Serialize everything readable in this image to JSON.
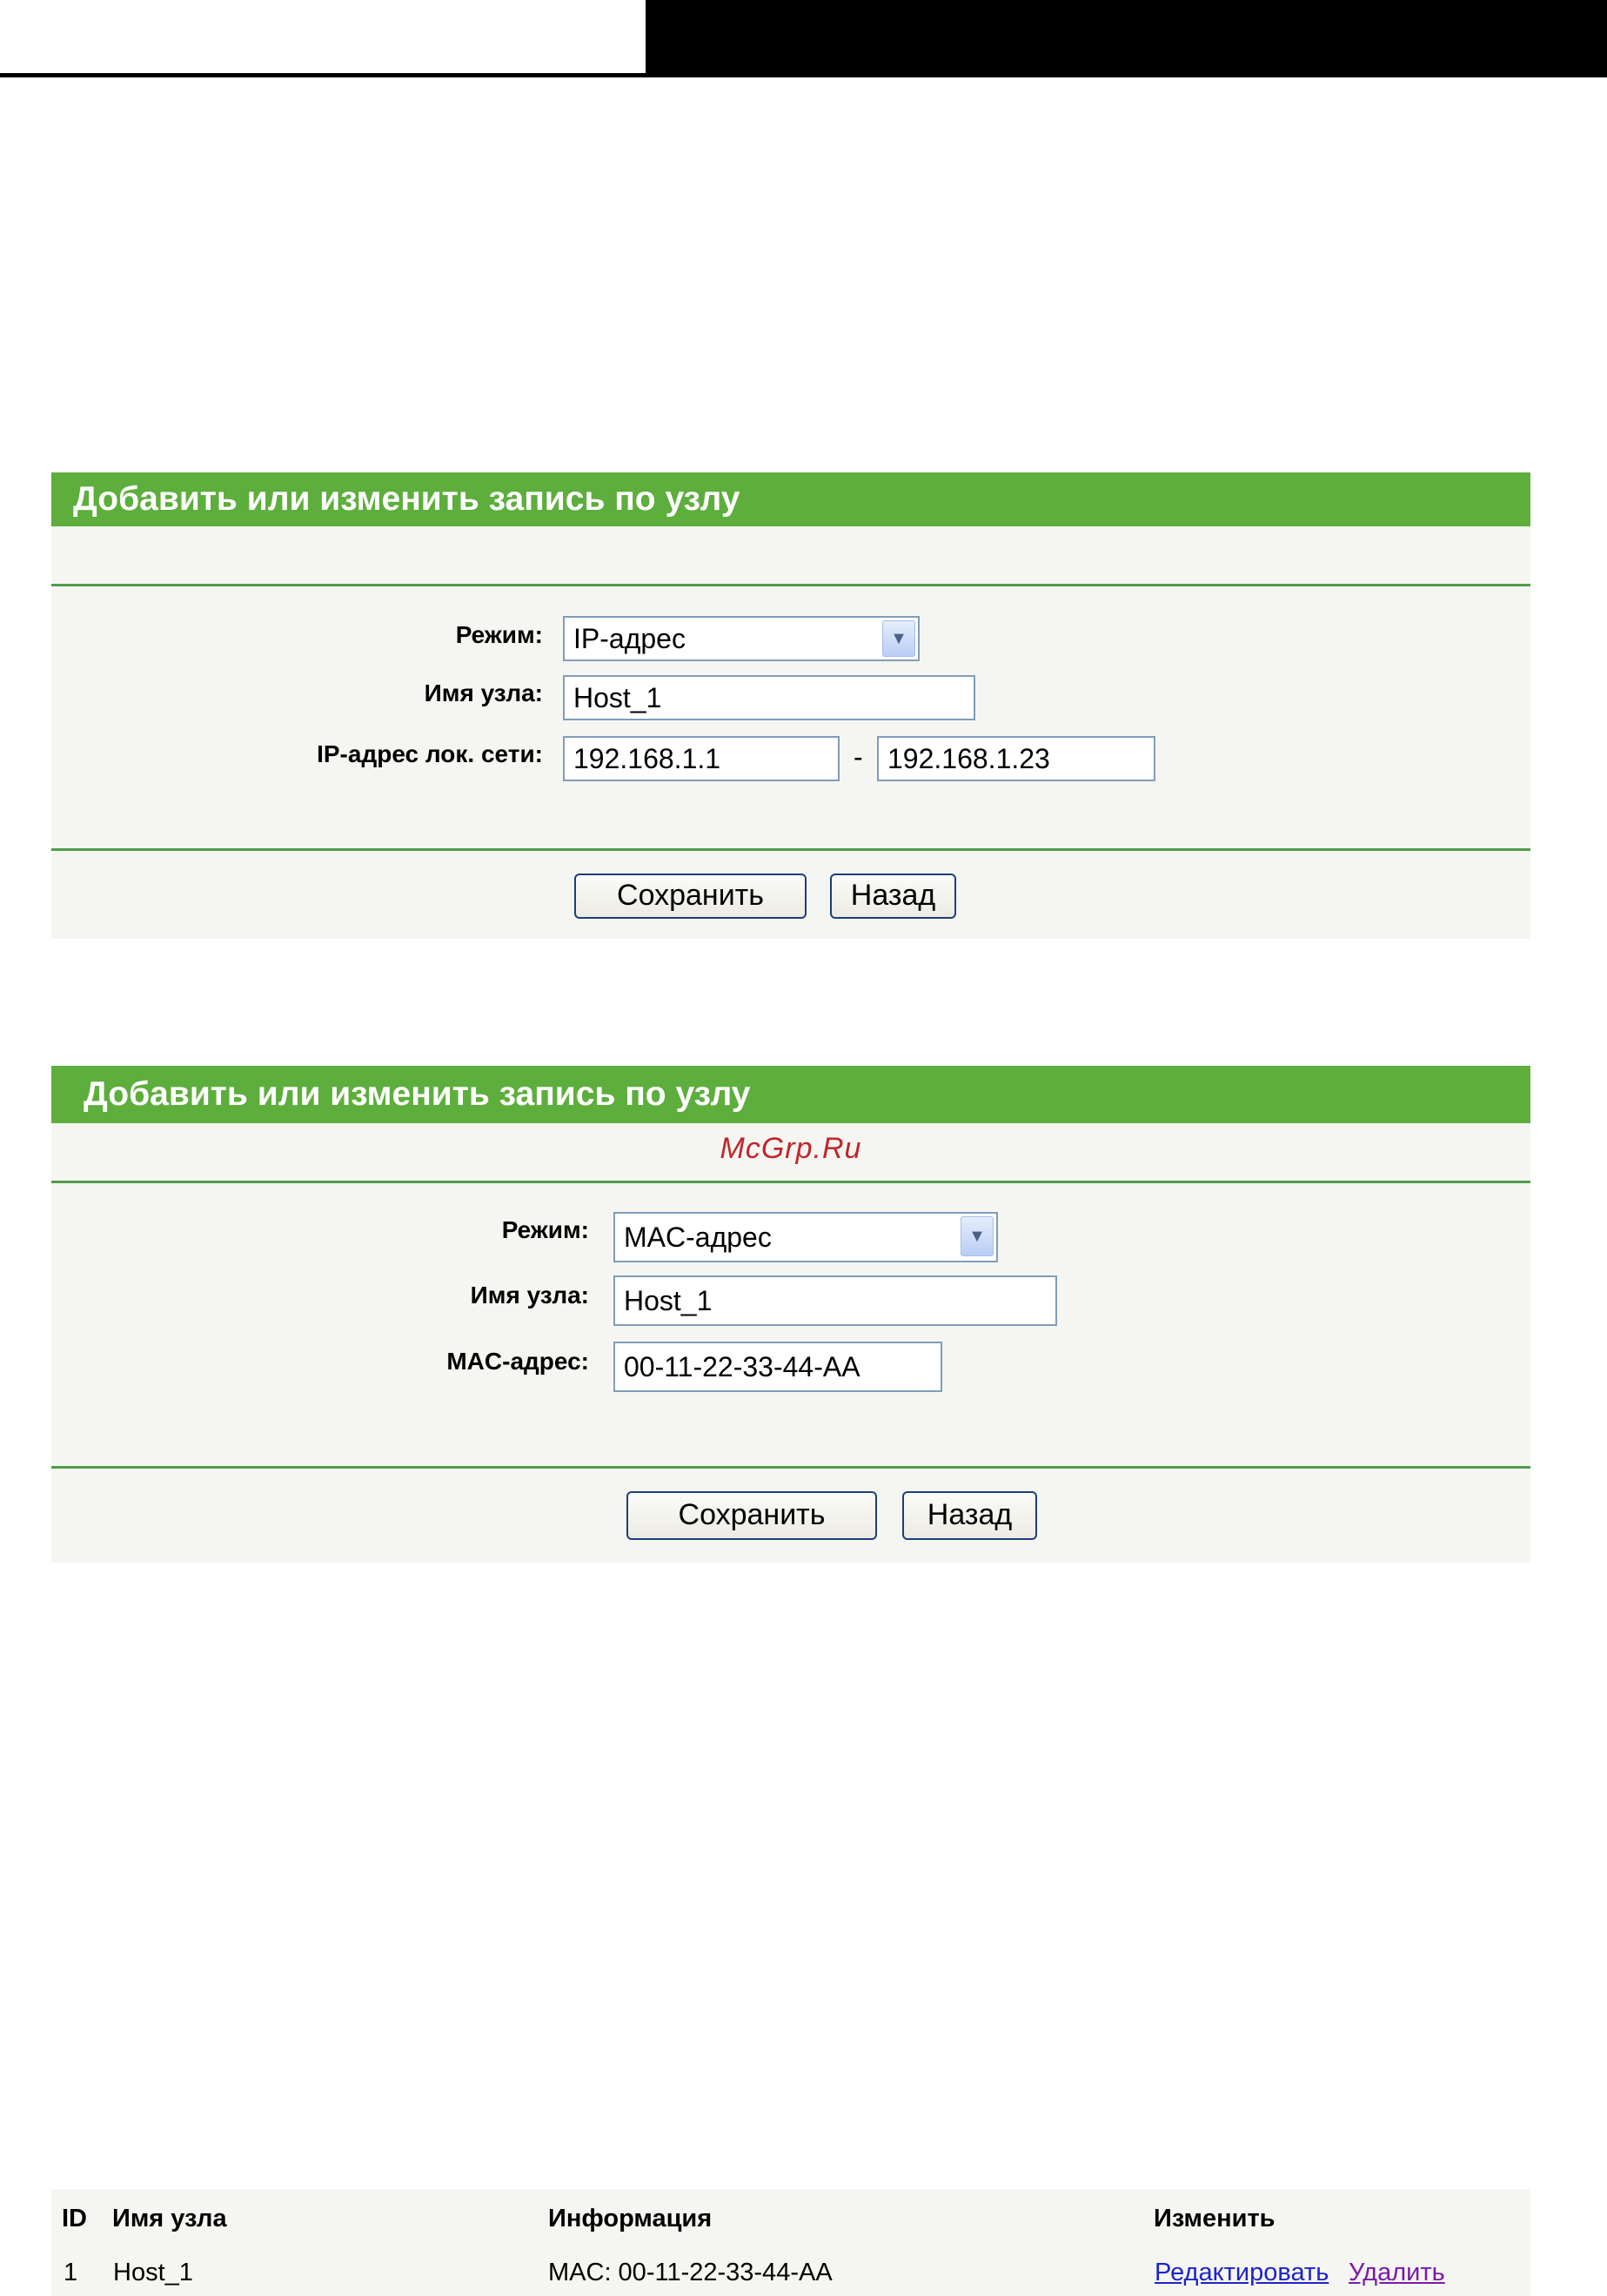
{
  "panel1": {
    "title": "Добавить или изменить запись по узлу",
    "mode_label": "Режим:",
    "mode_value": "IP-адрес",
    "host_label": "Имя узла:",
    "host_value": "Host_1",
    "ip_label": "IP-адрес лок. сети:",
    "ip_start": "192.168.1.1",
    "ip_separator": "-",
    "ip_end": "192.168.1.23",
    "save_label": "Сохранить",
    "back_label": "Назад"
  },
  "panel2": {
    "title": "Добавить или изменить запись по узлу",
    "watermark": "McGrp.Ru",
    "mode_label": "Режим:",
    "mode_value": "MAC-адрес",
    "host_label": "Имя узла:",
    "host_value": "Host_1",
    "mac_label": "MAC-адрес:",
    "mac_value": "00-11-22-33-44-AA",
    "save_label": "Сохранить",
    "back_label": "Назад"
  },
  "table": {
    "headers": [
      "ID",
      "Имя узла",
      "Информация",
      "Изменить"
    ],
    "rows": [
      {
        "id": "1",
        "host": "Host_1",
        "info": "MAC: 00-11-22-33-44-AA",
        "edit": "Редактировать",
        "delete": "Удалить"
      }
    ]
  },
  "colors": {
    "header_green": "#5dae3c",
    "panel_bg": "#f5f6f1",
    "divider_green": "#4f9d4a",
    "link_blue": "#1d24c8",
    "link_visited": "#7b1aa8",
    "watermark_red": "#c0262b"
  },
  "icons": {
    "select_arrow": "chevron-down-icon"
  }
}
